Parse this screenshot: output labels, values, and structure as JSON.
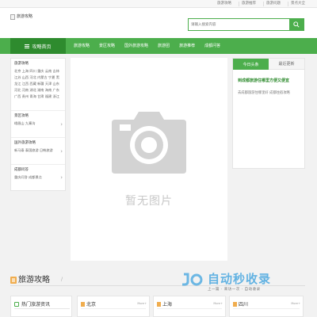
{
  "topbar": {
    "links": [
      "旅游攻略",
      "旅游推荐",
      "旅游问题",
      "景点大全"
    ]
  },
  "header": {
    "logo_alt": "旅游攻略",
    "search_placeholder": "请输入搜索内容"
  },
  "nav": {
    "home_label": "攻略首页",
    "items": [
      "旅游攻略",
      "景区攻略",
      "国外旅游攻略",
      "旅游团",
      "旅游推荐",
      "成都问答"
    ]
  },
  "sidebar": {
    "blocks": [
      {
        "title": "旅游攻略",
        "body": "北京 上海 四川 重庆 云南 吉林 江苏 山西 河北 内蒙古 宁夏 黑龙江 江西 西藏 新疆 天津 山东 河北 河南 湖北 湖南 海南 广东 广西 贵州 青海 甘肃 福建 浙江"
      },
      {
        "title": "景区攻略",
        "body": "峨眉山 九寨沟"
      },
      {
        "title": "国外旅游攻略",
        "body": "新马泰 泰国旅游 日韩旅游"
      },
      {
        "title": "成都问答",
        "body": "重庆问答 成都景点"
      }
    ]
  },
  "main": {
    "placeholder_text": "暂无图片"
  },
  "rightbox": {
    "tabs": [
      "今日头条",
      "最近更新"
    ],
    "headline": "到成都旅游住哪里方便又便宜",
    "desc": "去成都旅游住哪里好 成都住宿攻略"
  },
  "section": {
    "title": "旅游攻略",
    "slash": "/"
  },
  "cards": {
    "hot_news": "热门旅游资讯",
    "cols": [
      {
        "name": "北京",
        "more": "More+"
      },
      {
        "name": "上海",
        "more": "More+"
      },
      {
        "name": "四川",
        "more": "More+"
      }
    ]
  },
  "watermark": {
    "title": "自动秒收录",
    "sub": "上一篇 · 来访一次 · 自动收录"
  },
  "colors": {
    "accent": "#4cae4c",
    "accent_dark": "#2e8b2e",
    "orange": "#f0ad4e",
    "watermark": "#4aa8e0"
  }
}
